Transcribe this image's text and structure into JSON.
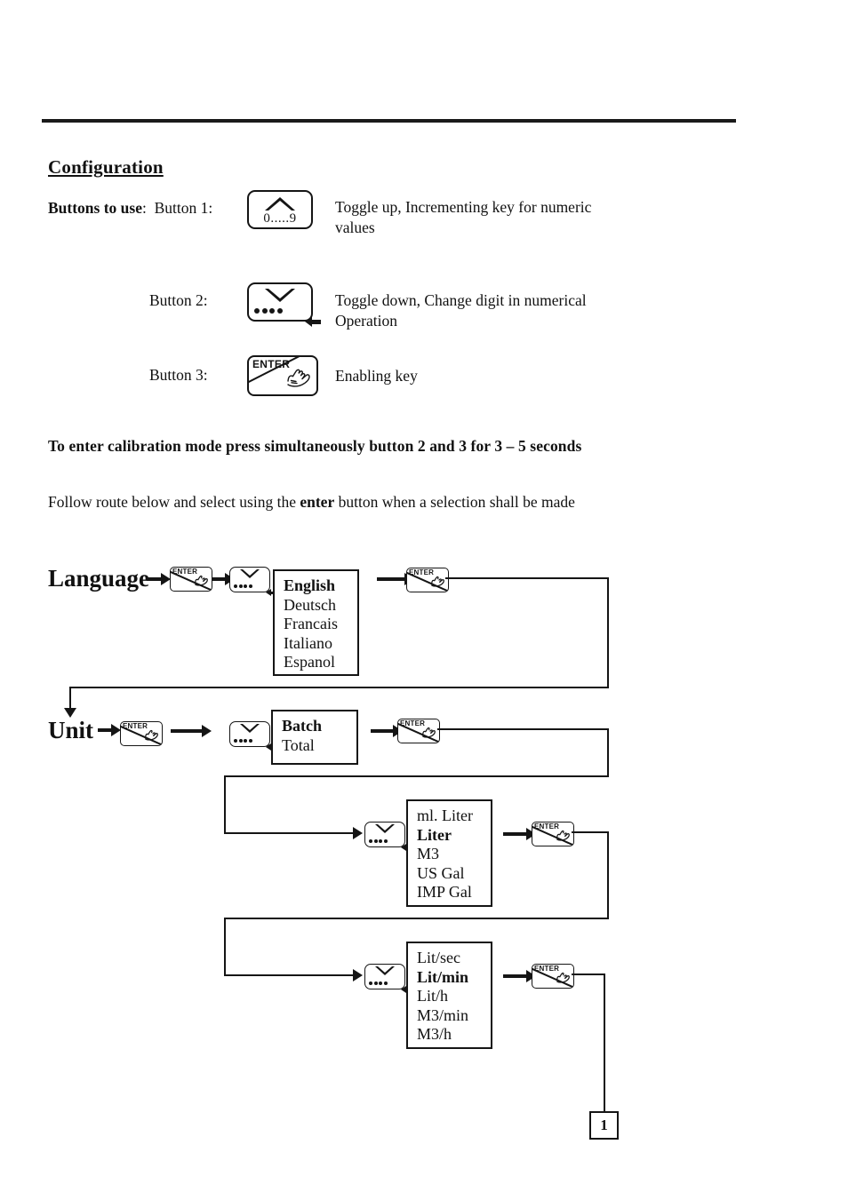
{
  "document": {
    "heading": "Configuration",
    "page_number": "1"
  },
  "buttons_section": {
    "intro_label": "Buttons to use",
    "intro_separator": ":",
    "rows": [
      {
        "label": "Button 1:",
        "icon": "toggle-up-key-icon",
        "icon_caption": "0.....9",
        "description": "Toggle up, Incrementing key for numeric values"
      },
      {
        "label": "Button 2:",
        "icon": "toggle-down-key-icon",
        "description": "Toggle down, Change digit in numerical Operation"
      },
      {
        "label": "Button 3:",
        "icon": "enter-key-icon",
        "icon_caption": "ENTER",
        "description": "Enabling key"
      }
    ]
  },
  "instructions": {
    "calibration": "To enter calibration mode press simultaneously button 2 and 3 for 3 – 5 seconds",
    "follow_route_prefix": "Follow route below and select using the ",
    "follow_route_emphasis": "enter",
    "follow_route_suffix": " button when a selection shall be made"
  },
  "flow": {
    "enter_caption": "ENTER",
    "steps": [
      {
        "name": "language",
        "label": "Language",
        "options": [
          {
            "text": "English",
            "selected": true
          },
          {
            "text": "Deutsch",
            "selected": false
          },
          {
            "text": "Francais",
            "selected": false
          },
          {
            "text": "Italiano",
            "selected": false
          },
          {
            "text": "Espanol",
            "selected": false
          }
        ]
      },
      {
        "name": "unit",
        "label": "Unit",
        "options": [
          {
            "text": "Batch",
            "selected": true
          },
          {
            "text": "Total",
            "selected": false
          }
        ]
      },
      {
        "name": "volume-unit",
        "label": "",
        "options": [
          {
            "text": "ml. Liter",
            "selected": false
          },
          {
            "text": "Liter",
            "selected": true
          },
          {
            "text": "M3",
            "selected": false
          },
          {
            "text": "US Gal",
            "selected": false
          },
          {
            "text": "IMP Gal",
            "selected": false
          }
        ]
      },
      {
        "name": "flow-rate-unit",
        "label": "",
        "options": [
          {
            "text": "Lit/sec",
            "selected": false
          },
          {
            "text": "Lit/min",
            "selected": true
          },
          {
            "text": "Lit/h",
            "selected": false
          },
          {
            "text": "M3/min",
            "selected": false
          },
          {
            "text": "M3/h",
            "selected": false
          }
        ]
      }
    ]
  },
  "colors": {
    "ink": "#151515",
    "paper": "#ffffff"
  }
}
